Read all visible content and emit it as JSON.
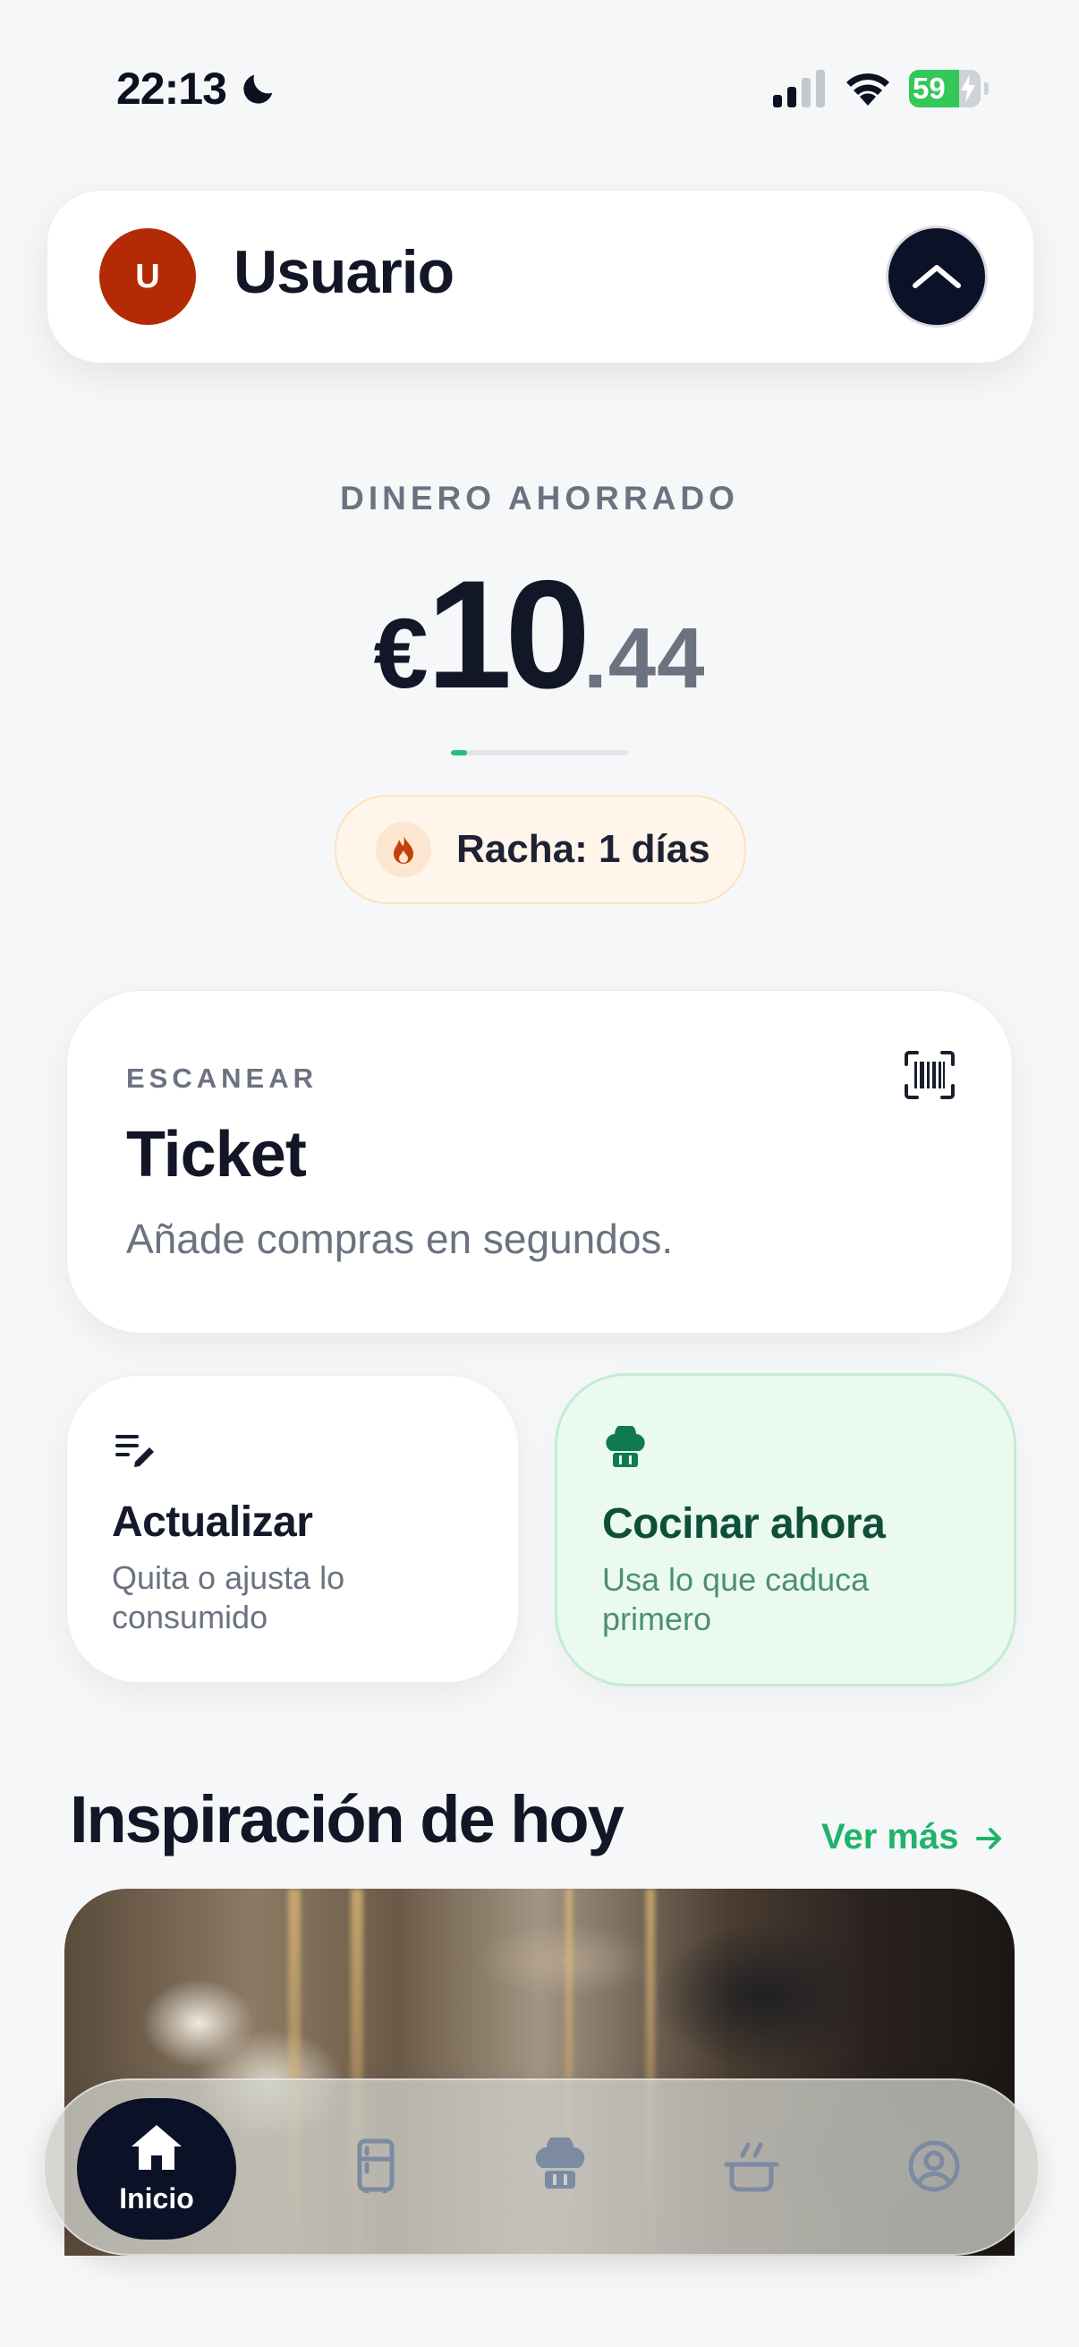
{
  "status_bar": {
    "time": "22:13",
    "battery": "59"
  },
  "header": {
    "avatar_initial": "U",
    "user_name": "Usuario"
  },
  "savings": {
    "label": "DINERO AHORRADO",
    "currency": "€",
    "whole": "10",
    "cents": ".44",
    "progress_fraction": 0.09
  },
  "streak": {
    "label": "Racha: 1 días"
  },
  "scan_card": {
    "kicker": "ESCANEAR",
    "title": "Ticket",
    "subtitle": "Añade compras en segundos."
  },
  "actions": {
    "update": {
      "title": "Actualizar",
      "subtitle": "Quita o ajusta lo consumido"
    },
    "cook": {
      "title": "Cocinar ahora",
      "subtitle": "Usa lo que caduca primero"
    }
  },
  "inspiration": {
    "title": "Inspiración de hoy",
    "see_more": "Ver más"
  },
  "nav": {
    "home_label": "Inicio",
    "items": [
      "fridge-icon",
      "chef-hat-icon",
      "cooking-pot-icon",
      "profile-icon"
    ]
  },
  "colors": {
    "accent": "#1fb36b",
    "dark": "#0b1126",
    "avatar": "#b32a05"
  }
}
